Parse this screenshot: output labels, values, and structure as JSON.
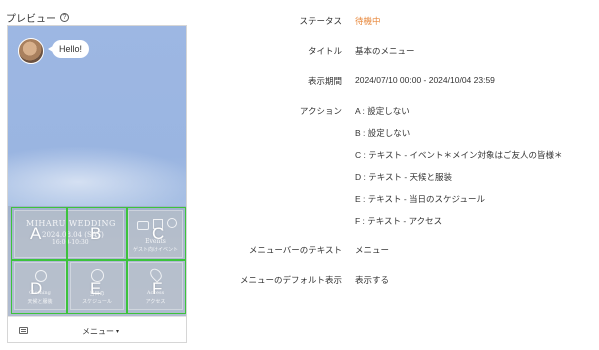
{
  "preview": {
    "title": "プレビュー",
    "help_glyph": "?",
    "bubble_text": "Hello!",
    "menu_bar_label": "メニュー",
    "menu_bar_caret": "▾",
    "tile_wedding_title": "MIHARU WEDDING",
    "tile_wedding_date": "2024.08.04 (SAT)",
    "tile_wedding_time": "16:00-10:30",
    "tile_events_title": "Events",
    "tile_events_caption": "ゲスト向けイベント",
    "tile_clothing_title": "Clothing",
    "tile_clothing_caption": "天候と服装",
    "tile_schedule_title": "当日の",
    "tile_schedule_caption": "スケジュール",
    "tile_access_title": "Access",
    "tile_access_caption": "アクセス",
    "areas": [
      "A",
      "B",
      "C",
      "D",
      "E",
      "F"
    ]
  },
  "details": {
    "status_label": "ステータス",
    "status_value": "待機中",
    "title_label": "タイトル",
    "title_value": "基本のメニュー",
    "period_label": "表示期間",
    "period_value": "2024/07/10 00:00 - 2024/10/04 23:59",
    "actions_label": "アクション",
    "actions": [
      "A : 設定しない",
      "B : 設定しない",
      "C : テキスト - イベント＊メイン対象はご友人の皆様＊",
      "D : テキスト - 天候と服装",
      "E : テキスト - 当日のスケジュール",
      "F : テキスト - アクセス"
    ],
    "menubar_text_label": "メニューバーのテキスト",
    "menubar_text_value": "メニュー",
    "default_display_label": "メニューのデフォルト表示",
    "default_display_value": "表示する"
  },
  "colors": {
    "status_accent": "#e8883c",
    "area_outline": "#3cc33c",
    "sky": "#9db7e3"
  },
  "icons": {
    "help": "help-circle-icon",
    "keyboard": "keyboard-icon",
    "caret": "chevron-down-icon"
  }
}
